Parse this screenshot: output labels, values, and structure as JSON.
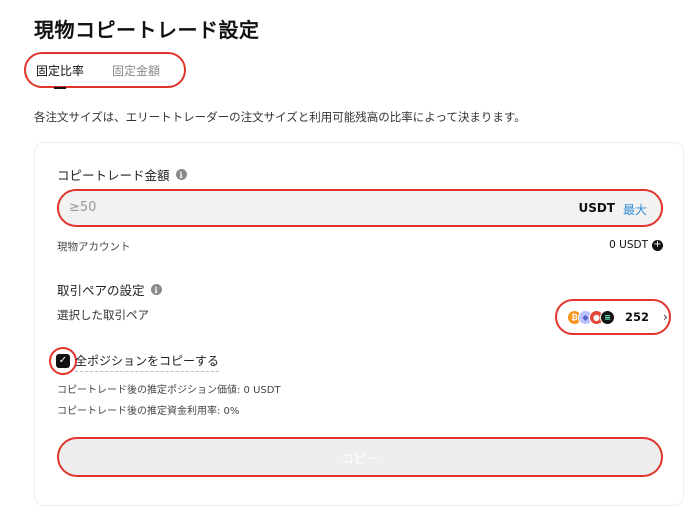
{
  "page": {
    "title": "現物コピートレード設定"
  },
  "tabs": [
    {
      "label": "固定比率",
      "active": true
    },
    {
      "label": "固定金額",
      "active": false
    }
  ],
  "description": "各注文サイズは、エリートトレーダーの注文サイズと利用可能残高の比率によって決まります。",
  "amount": {
    "label": "コピートレード金額",
    "placeholder": "≥50",
    "value": "",
    "unit": "USDT",
    "max_label": "最大"
  },
  "account": {
    "label": "現物アカウント",
    "balance": "0 USDT"
  },
  "pairs": {
    "label": "取引ペアの設定",
    "selected_label": "選択した取引ペア",
    "count": "252",
    "coins": [
      {
        "icon": "bitcoin-icon",
        "glyph": "₿",
        "color": "#f7931a"
      },
      {
        "icon": "eth-icon",
        "glyph": "◆",
        "color": "#b9c1ff"
      },
      {
        "icon": "red-coin-icon",
        "glyph": "●",
        "color": "#e2473a"
      },
      {
        "icon": "solana-icon",
        "glyph": "≡",
        "color": "#141414"
      }
    ]
  },
  "copy_all": {
    "label": "全ポジションをコピーする",
    "checked": true
  },
  "estimates": {
    "position_value": "コピートレード後の推定ポジション価値: 0 USDT",
    "fund_utilization": "コピートレード後の推定資金利用率: 0%"
  },
  "copy_button": {
    "label": "コピー"
  },
  "colors": {
    "highlight": "#e0352b",
    "link": "#2f8fd8",
    "disabled_button": "#eeeeee"
  }
}
